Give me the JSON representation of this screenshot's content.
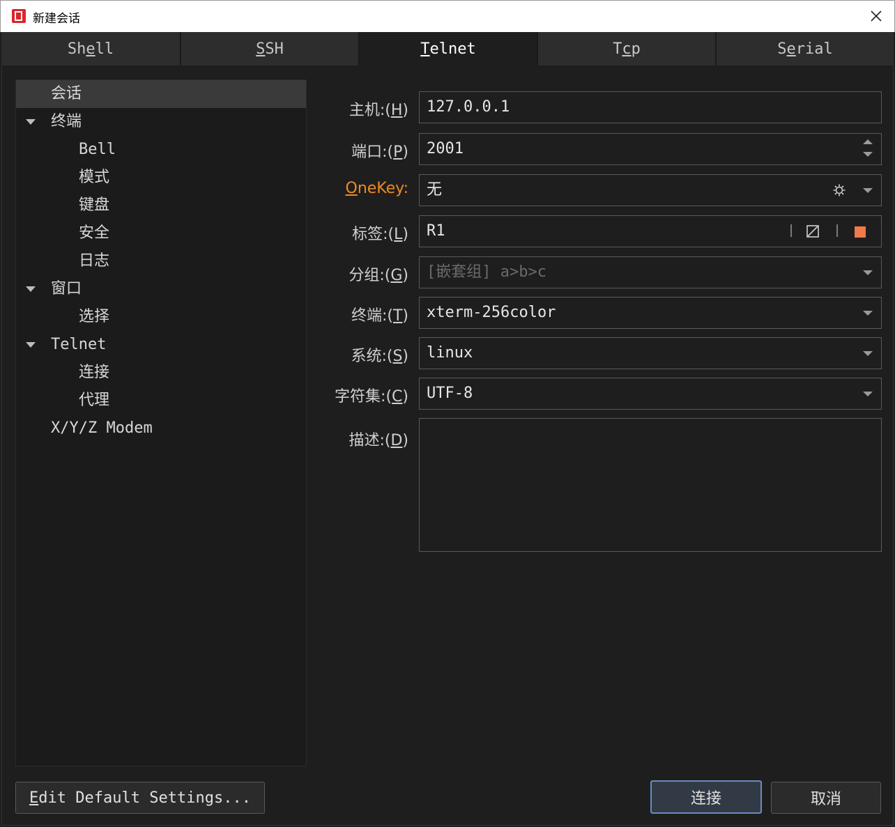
{
  "window": {
    "title": "新建会话"
  },
  "tabs": [
    {
      "pre": "Sh",
      "u": "e",
      "post": "ll"
    },
    {
      "pre": "",
      "u": "S",
      "post": "SH"
    },
    {
      "pre": "",
      "u": "T",
      "post": "elnet"
    },
    {
      "pre": "T",
      "u": "c",
      "post": "p"
    },
    {
      "pre": "S",
      "u": "e",
      "post": "rial"
    }
  ],
  "tree": [
    {
      "label": "会话"
    },
    {
      "label": "终端"
    },
    {
      "label": "Bell"
    },
    {
      "label": "模式"
    },
    {
      "label": "键盘"
    },
    {
      "label": "安全"
    },
    {
      "label": "日志"
    },
    {
      "label": "窗口"
    },
    {
      "label": "选择"
    },
    {
      "label": "Telnet"
    },
    {
      "label": "连接"
    },
    {
      "label": "代理"
    },
    {
      "label": "X/Y/Z Modem"
    }
  ],
  "form": {
    "host": {
      "pre": "主机:(",
      "key": "H",
      "post": ")",
      "value": "127.0.0.1"
    },
    "port": {
      "pre": "端口:(",
      "key": "P",
      "post": ")",
      "value": "2001"
    },
    "onekey": {
      "key": "O",
      "post": "neKey:",
      "value": "无"
    },
    "tag": {
      "pre": "标签:(",
      "key": "L",
      "post": ")",
      "value": "R1"
    },
    "group": {
      "pre": "分组:(",
      "key": "G",
      "post": ")",
      "placeholder": "[嵌套组] a>b>c"
    },
    "terminal": {
      "pre": "终端:(",
      "key": "T",
      "post": ")",
      "value": "xterm-256color"
    },
    "system": {
      "pre": "系统:(",
      "key": "S",
      "post": ")",
      "value": "linux"
    },
    "charset": {
      "pre": "字符集:(",
      "key": "C",
      "post": ")",
      "value": "UTF-8"
    },
    "desc": {
      "pre": "描述:(",
      "key": "D",
      "post": ")",
      "value": ""
    }
  },
  "buttons": {
    "edit_default_key": "E",
    "edit_default_rest": "dit Default Settings...",
    "connect": "连接",
    "cancel": "取消"
  },
  "colors": {
    "accent_orange": "#f08a24",
    "tag_color": "#f07a4a",
    "primary_border": "#6b8cc2"
  }
}
